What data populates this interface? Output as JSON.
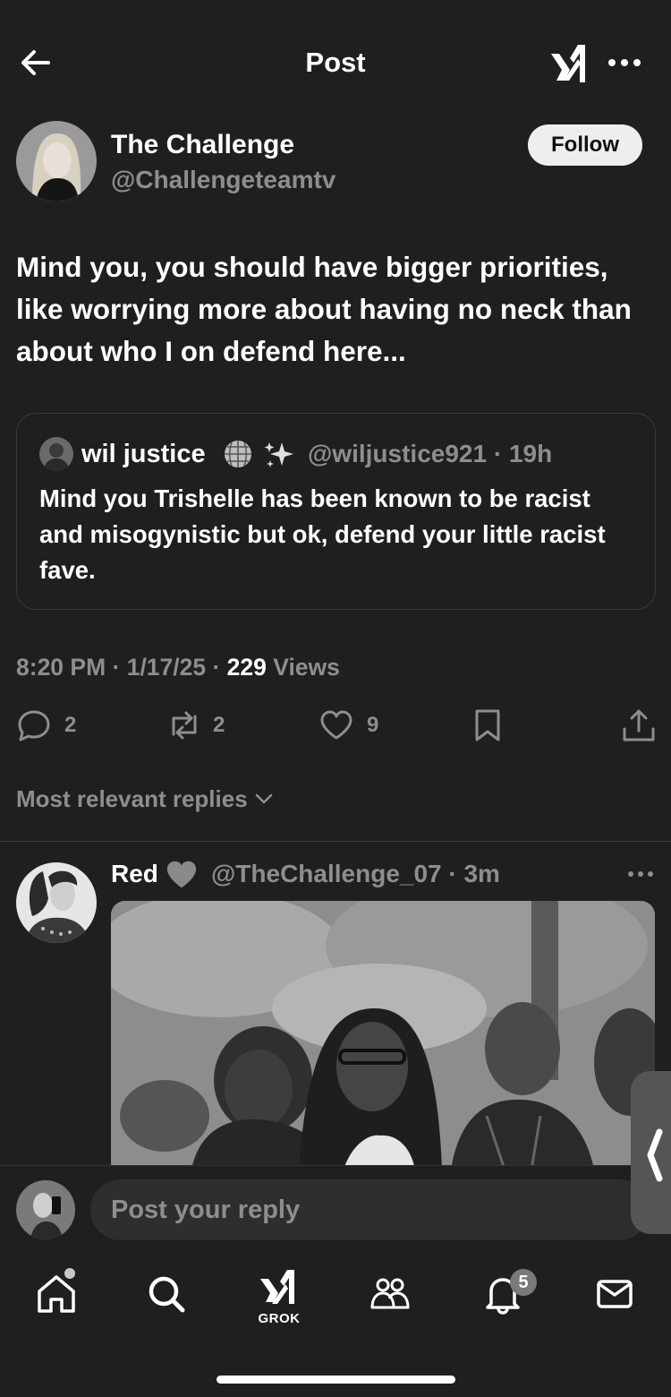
{
  "header": {
    "title": "Post",
    "icons": [
      "back-arrow-icon",
      "xai-logo-icon",
      "more-dots-icon"
    ]
  },
  "post": {
    "author_name": "The Challenge",
    "author_handle": "@Challengeteamtv",
    "follow_label": "Follow",
    "text": "Mind you, you should have bigger priorities, like worrying more about having no neck than about who I on defend here...",
    "timestamp": "8:20 PM · 1/17/25 · ",
    "views_count": "229",
    "views_label": " Views",
    "replies_count": "2",
    "reposts_count": "2",
    "likes_count": "9"
  },
  "quote": {
    "name": "wil justice",
    "emojis": [
      "disco-ball-icon",
      "sparkles-icon"
    ],
    "handle_time": "@wiljustice921 · 19h",
    "text": "Mind you Trishelle has been known to be racist and misogynistic but ok, defend your little racist fave."
  },
  "replies_sort_label": "Most relevant replies",
  "reply": {
    "name": "Red",
    "name_emoji": "grey-heart-icon",
    "handle_time": "@TheChallenge_07 · 3m"
  },
  "composer": {
    "placeholder": "Post your reply"
  },
  "nav": {
    "items": [
      "home-icon",
      "search-icon",
      "grok-icon",
      "communities-icon",
      "notifications-icon",
      "messages-icon"
    ],
    "grok_label": "GROK",
    "notifications_badge": "5"
  },
  "colors": {
    "background": "#1f1f1f",
    "text_primary": "#ffffff",
    "text_secondary": "#8e8e8e",
    "border": "#3a3a3a"
  }
}
